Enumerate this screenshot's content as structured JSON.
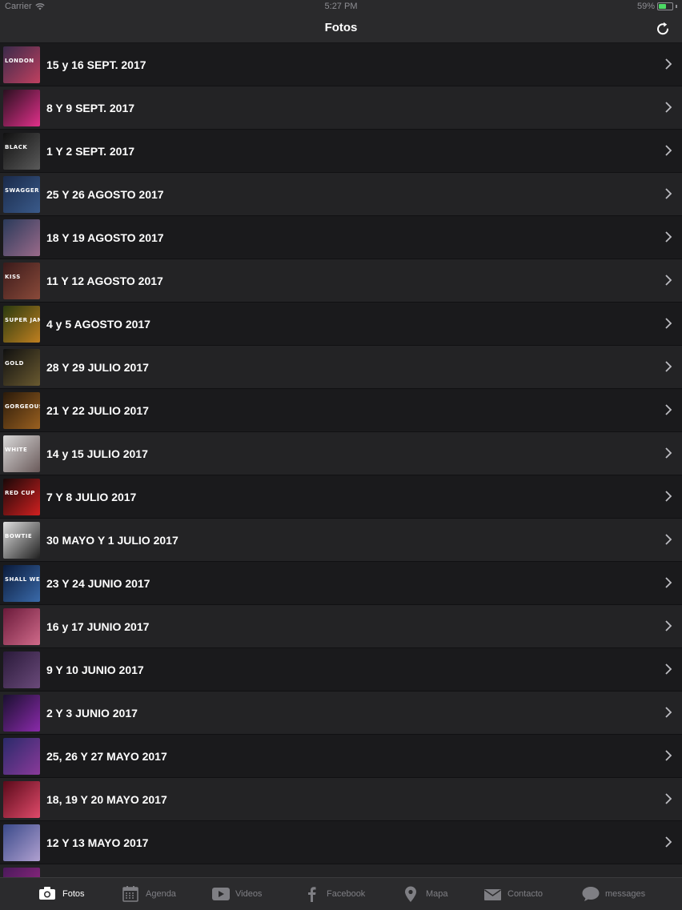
{
  "status": {
    "carrier": "Carrier",
    "time": "5:27 PM",
    "battery": "59%",
    "battery_level": 0.59
  },
  "navbar": {
    "title": "Fotos",
    "refresh_icon": "refresh-icon"
  },
  "albums": [
    {
      "label": "15 y 16 SEPT. 2017",
      "thumb_text": "LONDON",
      "colors": [
        "#3a2a4a",
        "#c04060"
      ]
    },
    {
      "label": "8 Y 9 SEPT. 2017",
      "thumb_text": "",
      "colors": [
        "#2a1020",
        "#e0308a"
      ]
    },
    {
      "label": "1 Y 2 SEPT. 2017",
      "thumb_text": "BLACK",
      "colors": [
        "#101010",
        "#5a5a5a"
      ]
    },
    {
      "label": "25 Y 26 AGOSTO 2017",
      "thumb_text": "SWAGGER",
      "colors": [
        "#1a2a4a",
        "#3a5a8a"
      ]
    },
    {
      "label": "18 Y 19 AGOSTO 2017",
      "thumb_text": "",
      "colors": [
        "#2a3a5a",
        "#9a6a8a"
      ]
    },
    {
      "label": "11 Y 12 AGOSTO 2017",
      "thumb_text": "KISS",
      "colors": [
        "#3a1a1a",
        "#8a4a3a"
      ]
    },
    {
      "label": "4 y 5 AGOSTO 2017",
      "thumb_text": "SUPER JAM",
      "colors": [
        "#2a3a10",
        "#c08020"
      ]
    },
    {
      "label": "28 Y 29 JULIO 2017",
      "thumb_text": "GOLD",
      "colors": [
        "#101010",
        "#6a5a30"
      ]
    },
    {
      "label": "21 Y 22 JULIO 2017",
      "thumb_text": "GORGEOUS",
      "colors": [
        "#2a1a0a",
        "#9a6020"
      ]
    },
    {
      "label": "14 y 15 JULIO 2017",
      "thumb_text": "WHITE",
      "colors": [
        "#d8d8d8",
        "#6a5a5a"
      ]
    },
    {
      "label": "7 Y 8 JULIO 2017",
      "thumb_text": "RED CUP",
      "colors": [
        "#1a0808",
        "#d02020"
      ]
    },
    {
      "label": "30 MAYO Y 1 JULIO 2017",
      "thumb_text": "BOWTIE",
      "colors": [
        "#e0e0e0",
        "#202020"
      ]
    },
    {
      "label": "23 Y 24 JUNIO 2017",
      "thumb_text": "SHALL WE DANCE",
      "colors": [
        "#0a1a3a",
        "#3a6aaa"
      ]
    },
    {
      "label": "16 y 17 JUNIO 2017",
      "thumb_text": "",
      "colors": [
        "#6a1a3a",
        "#d06a8a"
      ]
    },
    {
      "label": "9 Y 10 JUNIO 2017",
      "thumb_text": "",
      "colors": [
        "#2a1a3a",
        "#6a4a7a"
      ]
    },
    {
      "label": "2 Y 3 JUNIO 2017",
      "thumb_text": "",
      "colors": [
        "#1a1030",
        "#8a2aaa"
      ]
    },
    {
      "label": "25, 26 Y 27 MAYO 2017",
      "thumb_text": "",
      "colors": [
        "#2a2a6a",
        "#8a3a9a"
      ]
    },
    {
      "label": "18, 19 Y 20 MAYO 2017",
      "thumb_text": "",
      "colors": [
        "#5a0a1a",
        "#e04a6a"
      ]
    },
    {
      "label": "12 Y 13 MAYO 2017",
      "thumb_text": "",
      "colors": [
        "#3a4a8a",
        "#b0a0d0"
      ]
    },
    {
      "label": "",
      "thumb_text": "",
      "colors": [
        "#4a1a5a",
        "#a02a8a"
      ]
    }
  ],
  "tabs": [
    {
      "label": "Fotos",
      "icon": "camera-icon",
      "active": true
    },
    {
      "label": "Agenda",
      "icon": "calendar-icon",
      "active": false
    },
    {
      "label": "Videos",
      "icon": "play-icon",
      "active": false
    },
    {
      "label": "Facebook",
      "icon": "facebook-icon",
      "active": false
    },
    {
      "label": "Mapa",
      "icon": "map-pin-icon",
      "active": false
    },
    {
      "label": "Contacto",
      "icon": "envelope-icon",
      "active": false
    },
    {
      "label": "messages",
      "icon": "chat-bubble-icon",
      "active": false
    }
  ]
}
